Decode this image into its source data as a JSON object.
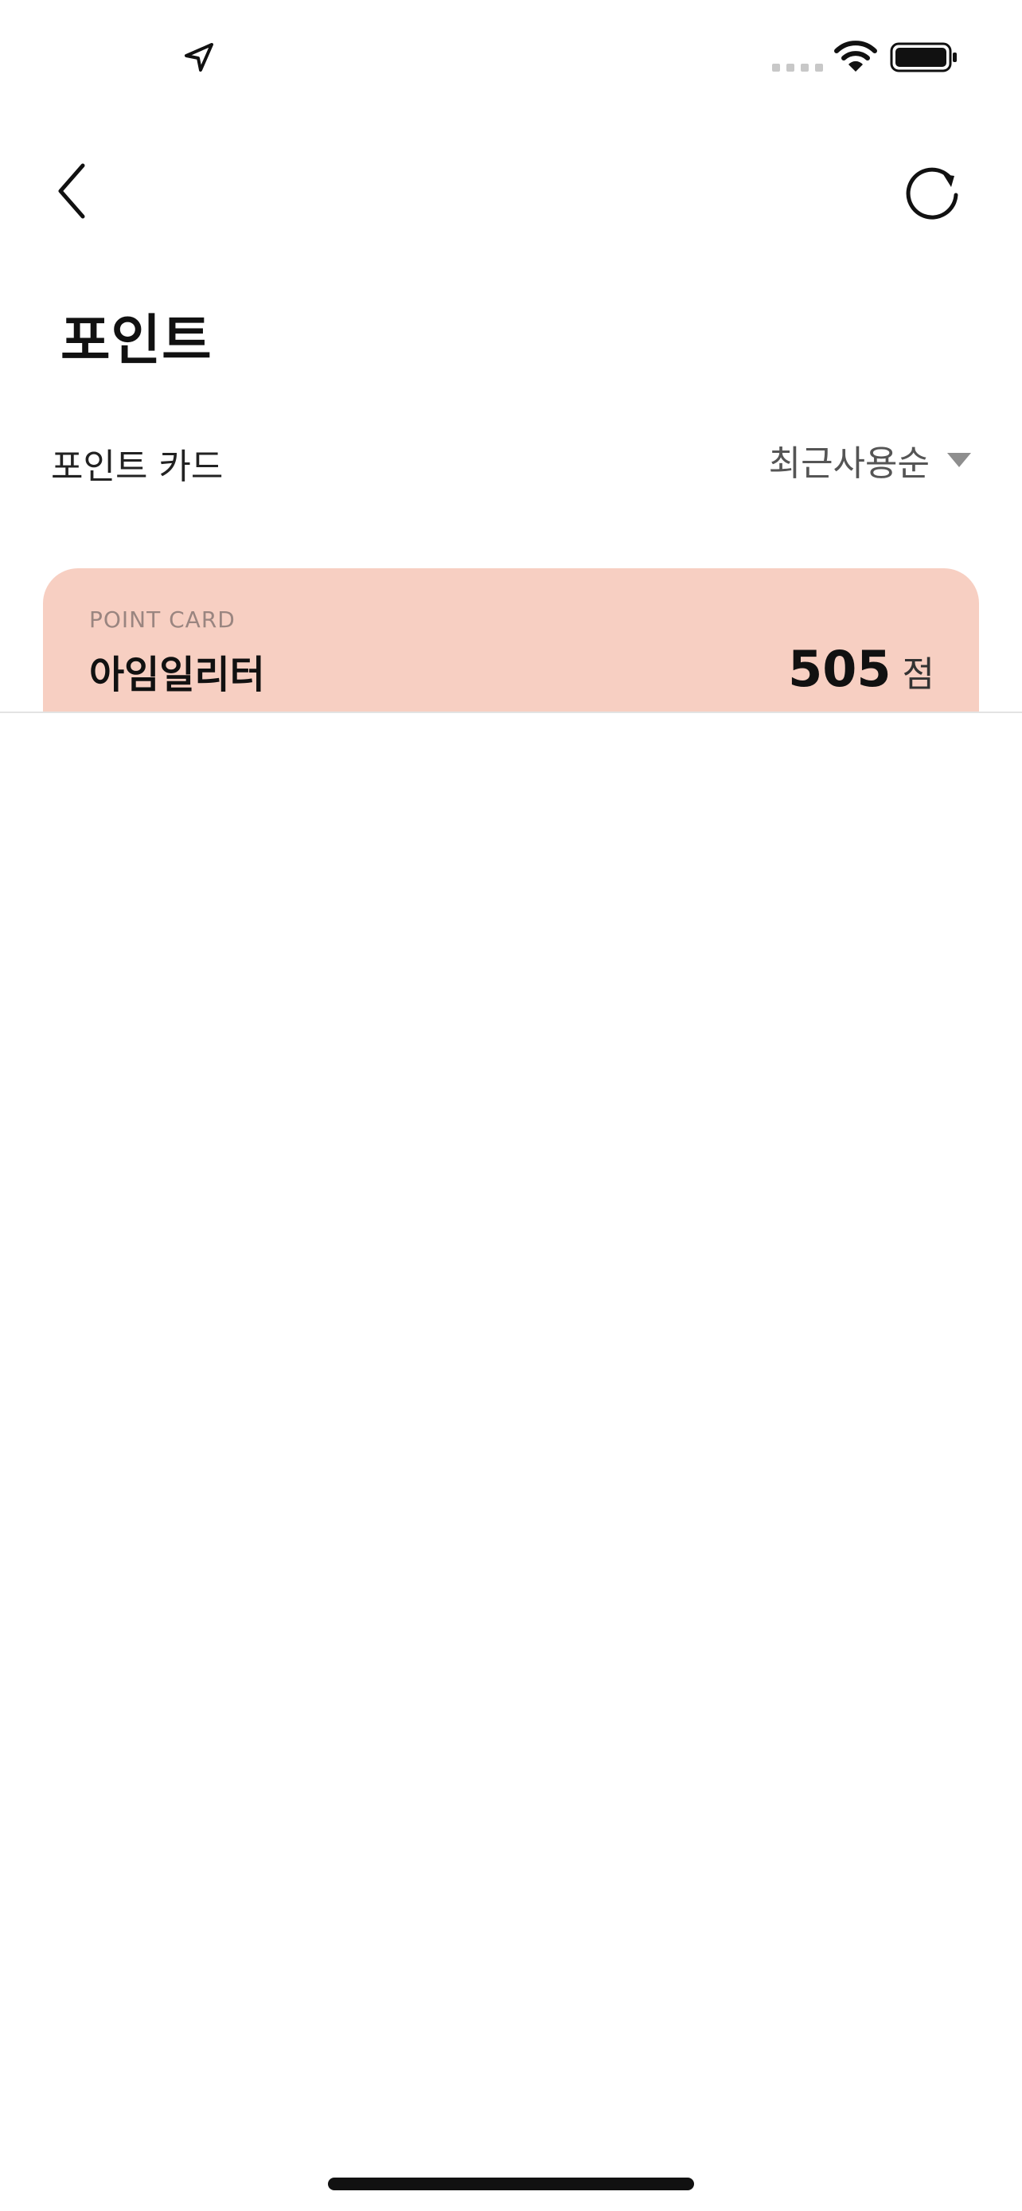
{
  "page": {
    "title": "포인트"
  },
  "section": {
    "label": "포인트 카드",
    "sort": {
      "selected": "최근사용순"
    }
  },
  "cards": [
    {
      "kicker": "POINT CARD",
      "name": "아임일리터",
      "points": "505",
      "unit": "점"
    }
  ],
  "icons": {
    "back": "chevron-left-icon",
    "refresh": "refresh-icon",
    "sort": "caret-down-icon"
  },
  "colors": {
    "card_background": "#f7cfc2",
    "text_primary": "#111111",
    "text_secondary": "#555555"
  }
}
